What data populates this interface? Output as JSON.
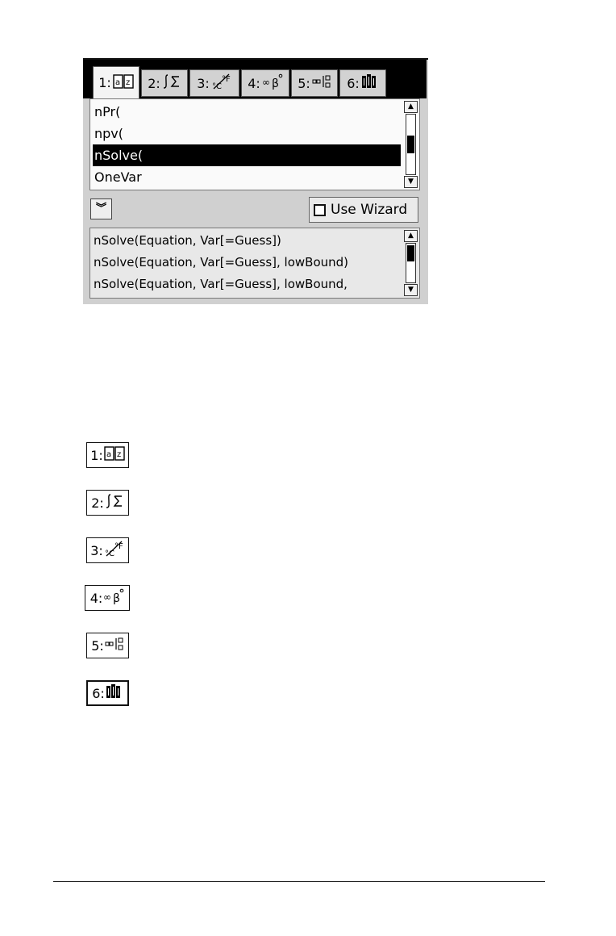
{
  "catalog": {
    "tabs": [
      {
        "number": "1:",
        "icon": "alphabetical-book-icon"
      },
      {
        "number": "2:",
        "icon": "integral-sigma-icon"
      },
      {
        "number": "3:",
        "icon": "unit-conversion-icon"
      },
      {
        "number": "4:",
        "icon": "infinity-beta-icon"
      },
      {
        "number": "5:",
        "icon": "template-icon"
      },
      {
        "number": "6:",
        "icon": "library-icon"
      }
    ],
    "active_tab": 0,
    "list_items": [
      "nPr(",
      "npv(",
      "nSolve(",
      "OneVar"
    ],
    "selected_item": 2,
    "wizard_label": "Use Wizard",
    "wizard_checked": false,
    "syntax_lines": [
      "nSolve(Equation, Var[=Guess])",
      "nSolve(Equation, Var[=Guess], lowBound)",
      "nSolve(Equation, Var[=Guess], lowBound,"
    ]
  },
  "legend": [
    {
      "number": "1:",
      "icon": "alphabetical-book-icon"
    },
    {
      "number": "2:",
      "icon": "integral-sigma-icon"
    },
    {
      "number": "3:",
      "icon": "unit-conversion-icon"
    },
    {
      "number": "4:",
      "icon": "infinity-beta-icon"
    },
    {
      "number": "5:",
      "icon": "template-icon"
    },
    {
      "number": "6:",
      "icon": "library-icon"
    }
  ]
}
